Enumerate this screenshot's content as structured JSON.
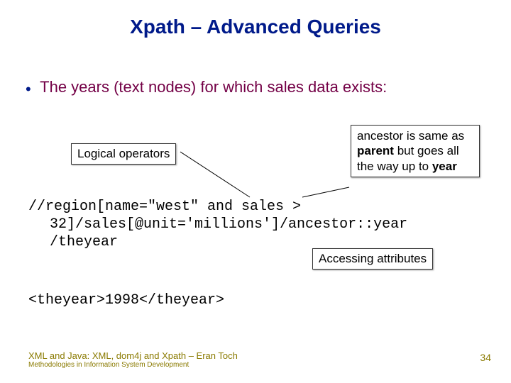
{
  "title": "Xpath – Advanced Queries",
  "bullet": "The years (text nodes) for which sales data exists:",
  "labels": {
    "logical_operators": "Logical operators",
    "ancestor_note_pre": "ancestor is same as ",
    "ancestor_note_bold1": "parent",
    "ancestor_note_mid": " but goes all the way up to ",
    "ancestor_note_bold2": "year",
    "accessing_attributes": "Accessing attributes"
  },
  "code": {
    "line1": "//region[name=\"west\" and sales >",
    "line2": "32]/sales[@unit='millions']/ancestor::year",
    "line3": "/theyear",
    "result": "<theyear>1998</theyear>"
  },
  "footer": {
    "main": "XML and Java: XML, dom4j and Xpath – Eran Toch",
    "sub": "Methodologies in Information System Development"
  },
  "page_number": "34"
}
